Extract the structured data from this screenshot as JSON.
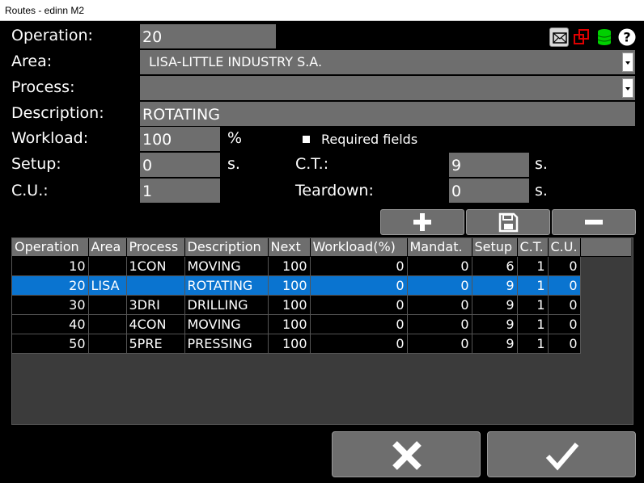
{
  "window": {
    "title": "Routes - edinn M2"
  },
  "labels": {
    "operation": "Operation:",
    "area": "Area:",
    "process": "Process:",
    "description": "Description:",
    "workload": "Workload:",
    "setup": "Setup:",
    "cu": "C.U.:",
    "ct": "C.T.:",
    "teardown": "Teardown:",
    "required_fields": "Required fields"
  },
  "fields": {
    "operation": "20",
    "area": "LISA-LITTLE INDUSTRY S.A.",
    "process": "",
    "description": "ROTATING",
    "workload": "100",
    "setup": "0",
    "cu": "1",
    "ct": "9",
    "teardown": "0"
  },
  "units": {
    "workload": "%",
    "setup": "s.",
    "ct": "s.",
    "teardown": "s."
  },
  "top_icons": [
    "mail-icon",
    "copy-windows-icon",
    "database-icon",
    "help-icon"
  ],
  "colors": {
    "selection": "#0a74d0",
    "field_bg": "#6e6e6e",
    "db_icon": "#00d000",
    "copy_icon": "#d00000"
  },
  "table": {
    "headers": [
      "Operation",
      "Area",
      "Process",
      "Description",
      "Next",
      "Workload(%)",
      "Mandat.",
      "Setup",
      "C.T.",
      "C.U."
    ],
    "rows": [
      [
        "10",
        "",
        "1CON",
        "MOVING",
        "100",
        "0",
        "0",
        "6",
        "1",
        "0"
      ],
      [
        "20",
        "LISA",
        "",
        "ROTATING",
        "100",
        "0",
        "0",
        "9",
        "1",
        "0"
      ],
      [
        "30",
        "",
        "3DRI",
        "DRILLING",
        "100",
        "0",
        "0",
        "9",
        "1",
        "0"
      ],
      [
        "40",
        "",
        "4CON",
        "MOVING",
        "100",
        "0",
        "0",
        "9",
        "1",
        "0"
      ],
      [
        "50",
        "",
        "5PRE",
        "PRESSING",
        "100",
        "0",
        "0",
        "9",
        "1",
        "0"
      ]
    ],
    "selected_row_index": 1
  }
}
